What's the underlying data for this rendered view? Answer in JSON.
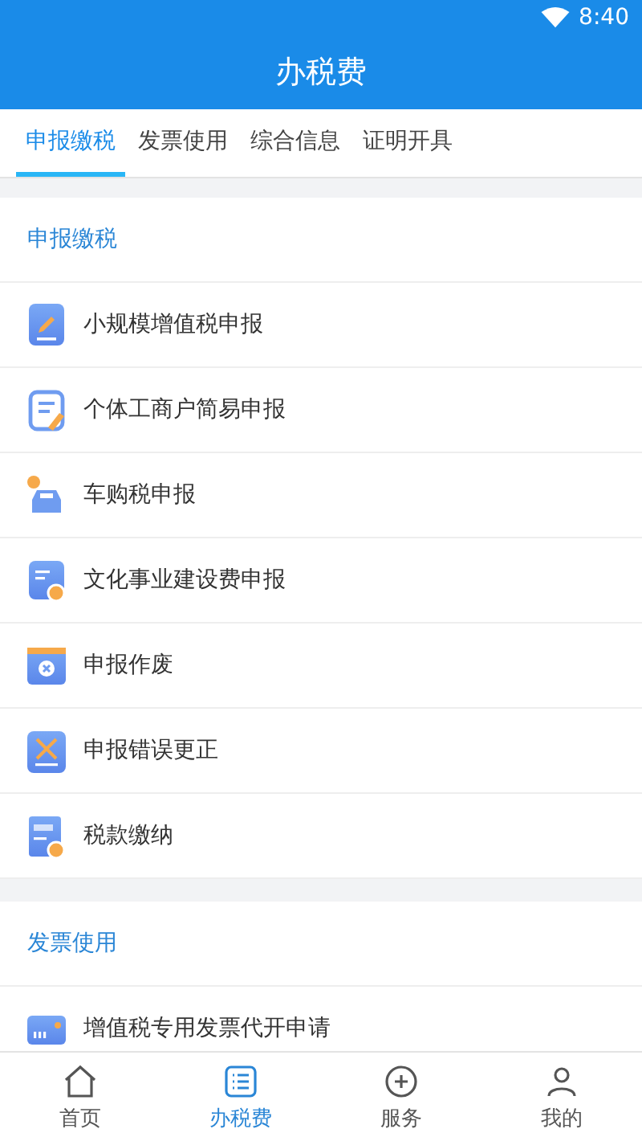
{
  "status_bar": {
    "time": "8:40"
  },
  "header": {
    "title": "办税费"
  },
  "tabs": [
    {
      "label": "申报缴税",
      "selected": true
    },
    {
      "label": "发票使用",
      "selected": false
    },
    {
      "label": "综合信息",
      "selected": false
    },
    {
      "label": "证明开具",
      "selected": false
    }
  ],
  "sections": [
    {
      "title": "申报缴税",
      "items": [
        {
          "label": "小规模增值税申报"
        },
        {
          "label": "个体工商户简易申报"
        },
        {
          "label": "车购税申报"
        },
        {
          "label": "文化事业建设费申报"
        },
        {
          "label": "申报作废"
        },
        {
          "label": "申报错误更正"
        },
        {
          "label": "税款缴纳"
        }
      ]
    },
    {
      "title": "发票使用",
      "items": [
        {
          "label": "增值税专用发票代开申请"
        }
      ]
    }
  ],
  "bottom_nav": [
    {
      "label": "首页",
      "selected": false
    },
    {
      "label": "办税费",
      "selected": true
    },
    {
      "label": "服务",
      "selected": false
    },
    {
      "label": "我的",
      "selected": false
    }
  ]
}
